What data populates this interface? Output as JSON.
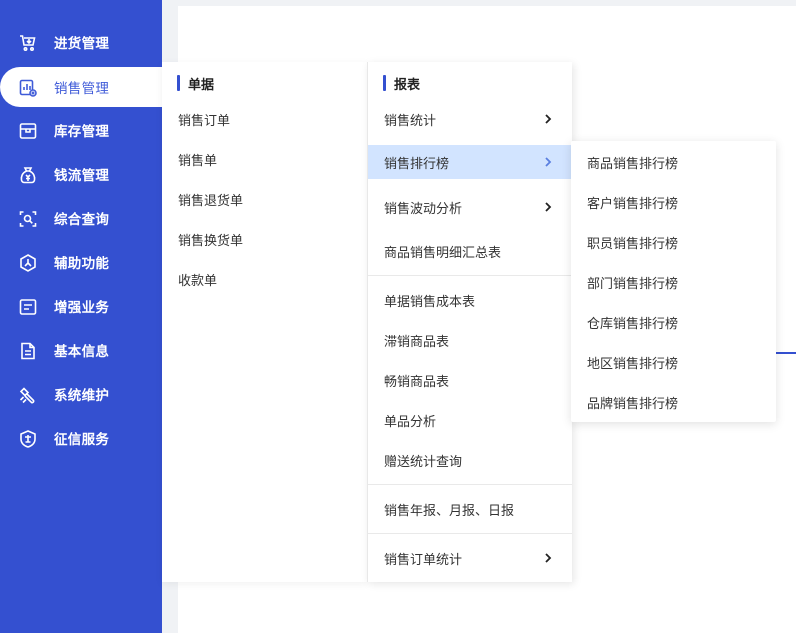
{
  "sidebar": {
    "items": [
      {
        "label": "进货管理",
        "icon": "cart-icon"
      },
      {
        "label": "销售管理",
        "icon": "sales-chart-icon"
      },
      {
        "label": "库存管理",
        "icon": "box-icon"
      },
      {
        "label": "钱流管理",
        "icon": "money-bag-icon"
      },
      {
        "label": "综合查询",
        "icon": "search-scan-icon"
      },
      {
        "label": "辅助功能",
        "icon": "hexagon-icon"
      },
      {
        "label": "增强业务",
        "icon": "form-icon"
      },
      {
        "label": "基本信息",
        "icon": "document-icon"
      },
      {
        "label": "系统维护",
        "icon": "wrench-icon"
      },
      {
        "label": "征信服务",
        "icon": "shield-icon"
      }
    ],
    "active_index": 1
  },
  "menu": {
    "documents": {
      "title": "单据",
      "items": [
        "销售订单",
        "销售单",
        "销售退货单",
        "销售换货单",
        "收款单"
      ]
    },
    "reports": {
      "title": "报表",
      "items": [
        {
          "label": "销售统计",
          "has_submenu": true
        },
        {
          "label": "销售排行榜",
          "has_submenu": true,
          "highlighted": true
        },
        {
          "label": "销售波动分析",
          "has_submenu": true
        },
        {
          "label": "商品销售明细汇总表",
          "has_submenu": false
        },
        {
          "label": "单据销售成本表",
          "has_submenu": false
        },
        {
          "label": "滞销商品表",
          "has_submenu": false
        },
        {
          "label": "畅销商品表",
          "has_submenu": false
        },
        {
          "label": "单品分析",
          "has_submenu": false
        },
        {
          "label": "赠送统计查询",
          "has_submenu": false
        },
        {
          "label": "销售年报、月报、日报",
          "has_submenu": false
        },
        {
          "label": "销售订单统计",
          "has_submenu": true
        }
      ]
    },
    "ranking_submenu": {
      "items": [
        "商品销售排行榜",
        "客户销售排行榜",
        "职员销售排行榜",
        "部门销售排行榜",
        "仓库销售排行榜",
        "地区销售排行榜",
        "品牌销售排行榜"
      ]
    }
  },
  "colors": {
    "sidebar_bg": "#3450d0",
    "accent": "#3f5bd8",
    "highlight_bg": "#d2e4ff"
  }
}
